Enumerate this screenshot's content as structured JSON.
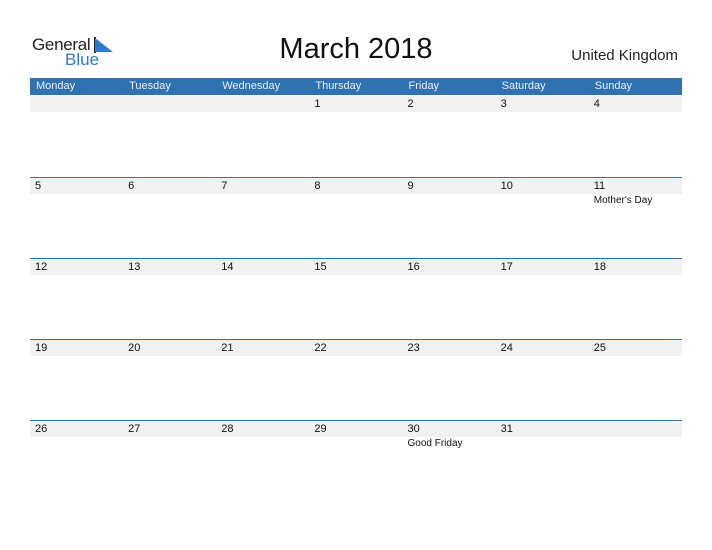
{
  "logo": {
    "word1": "General",
    "word2": "Blue"
  },
  "title": "March 2018",
  "country": "United Kingdom",
  "colors": {
    "accent": "#2f72b2",
    "band": "#f1f1f1"
  },
  "weekdays": [
    "Monday",
    "Tuesday",
    "Wednesday",
    "Thursday",
    "Friday",
    "Saturday",
    "Sunday"
  ],
  "weeks": [
    {
      "days": [
        "",
        "",
        "",
        "1",
        "2",
        "3",
        "4"
      ],
      "events": [
        "",
        "",
        "",
        "",
        "",
        "",
        ""
      ]
    },
    {
      "days": [
        "5",
        "6",
        "7",
        "8",
        "9",
        "10",
        "11"
      ],
      "events": [
        "",
        "",
        "",
        "",
        "",
        "",
        "Mother's Day"
      ]
    },
    {
      "days": [
        "12",
        "13",
        "14",
        "15",
        "16",
        "17",
        "18"
      ],
      "events": [
        "",
        "",
        "",
        "",
        "",
        "",
        ""
      ]
    },
    {
      "days": [
        "19",
        "20",
        "21",
        "22",
        "23",
        "24",
        "25"
      ],
      "events": [
        "",
        "",
        "",
        "",
        "",
        "",
        ""
      ]
    },
    {
      "days": [
        "26",
        "27",
        "28",
        "29",
        "30",
        "31",
        ""
      ],
      "events": [
        "",
        "",
        "",
        "",
        "Good Friday",
        "",
        ""
      ]
    }
  ]
}
